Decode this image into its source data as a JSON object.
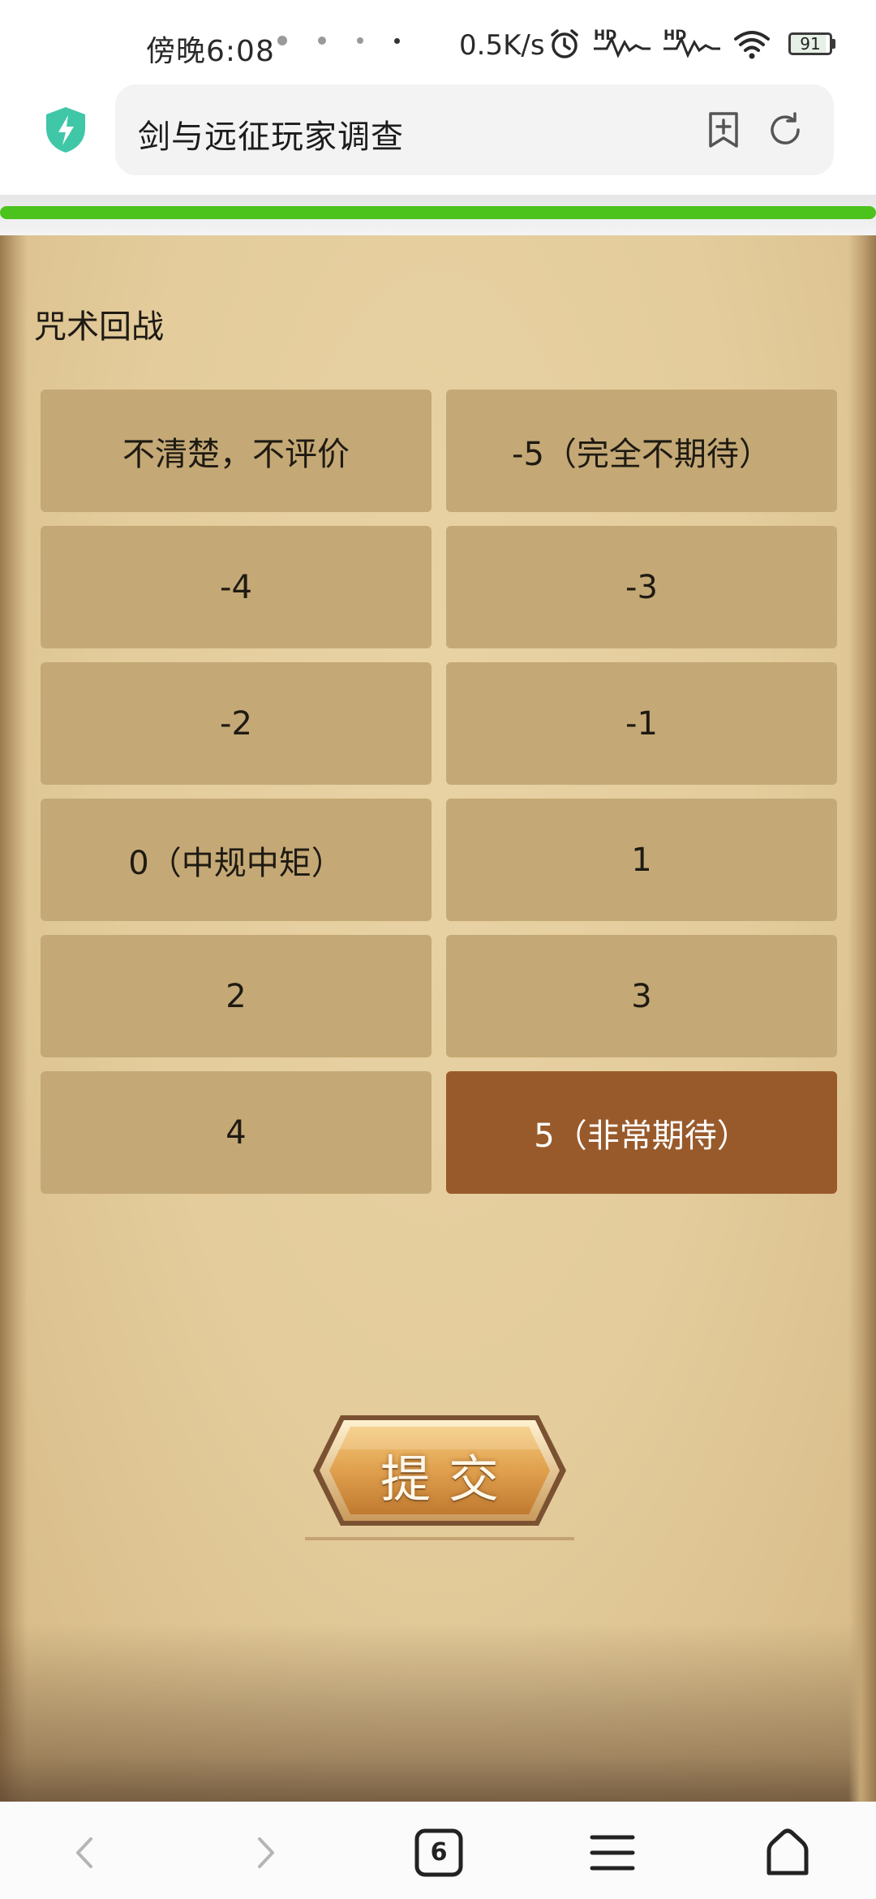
{
  "status_bar": {
    "time": "傍晚6:08",
    "net_speed": "0.5K/s",
    "hd_label_1": "HD",
    "hd_label_2": "HD",
    "battery": "91",
    "icons": [
      "alarm-icon",
      "signal-icon",
      "signal-icon",
      "wifi-icon",
      "battery-icon"
    ]
  },
  "browser": {
    "page_title": "剑与远征玩家调查",
    "load_progress": 1.0,
    "icons": [
      "shield-icon",
      "add-bookmark-icon",
      "refresh-icon"
    ]
  },
  "survey": {
    "question": "咒术回战",
    "options": [
      {
        "label": "不清楚，不评价",
        "selected": false
      },
      {
        "label": "-5（完全不期待）",
        "selected": false
      },
      {
        "label": "-4",
        "selected": false
      },
      {
        "label": "-3",
        "selected": false
      },
      {
        "label": "-2",
        "selected": false
      },
      {
        "label": "-1",
        "selected": false
      },
      {
        "label": "0（中规中矩）",
        "selected": false
      },
      {
        "label": "1",
        "selected": false
      },
      {
        "label": "2",
        "selected": false
      },
      {
        "label": "3",
        "selected": false
      },
      {
        "label": "4",
        "selected": false
      },
      {
        "label": "5（非常期待）",
        "selected": true
      }
    ],
    "submit_label": "提交"
  },
  "bottom_nav": {
    "tab_count": "6",
    "icons": [
      "back-icon",
      "forward-icon",
      "tabs-icon",
      "menu-icon",
      "home-icon"
    ]
  },
  "colors": {
    "option_bg": "#c4a976",
    "option_selected_bg": "#995a2b",
    "progress": "#4cc21d",
    "shield": "#3fc7a8"
  }
}
